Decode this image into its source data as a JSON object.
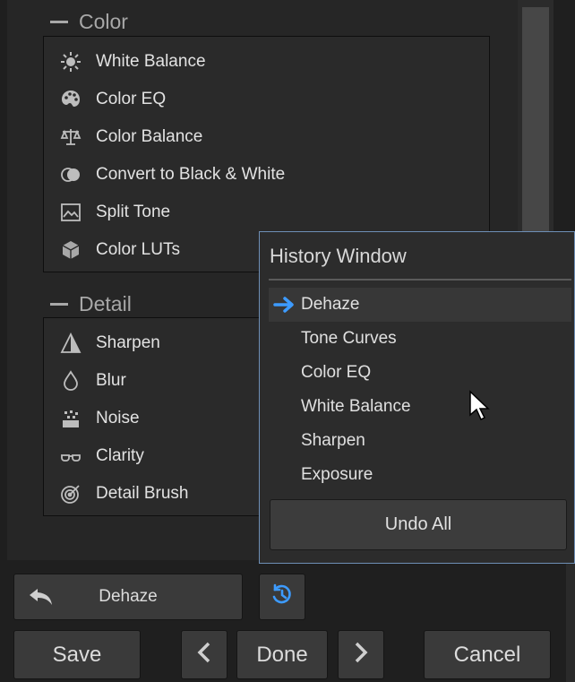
{
  "color_section": {
    "header": "Color",
    "items": [
      {
        "label": "White Balance",
        "icon": "sun-icon"
      },
      {
        "label": "Color EQ",
        "icon": "palette-icon"
      },
      {
        "label": "Color Balance",
        "icon": "scales-icon"
      },
      {
        "label": "Convert to Black & White",
        "icon": "bw-circles-icon"
      },
      {
        "label": "Split Tone",
        "icon": "split-tone-icon"
      },
      {
        "label": "Color LUTs",
        "icon": "cube-icon"
      }
    ]
  },
  "detail_section": {
    "header": "Detail",
    "items": [
      {
        "label": "Sharpen",
        "icon": "sharpen-icon"
      },
      {
        "label": "Blur",
        "icon": "droplet-icon"
      },
      {
        "label": "Noise",
        "icon": "noise-icon"
      },
      {
        "label": "Clarity",
        "icon": "glasses-icon"
      },
      {
        "label": "Detail Brush",
        "icon": "target-brush-icon"
      }
    ]
  },
  "history": {
    "title": "History Window",
    "items": [
      "Dehaze",
      "Tone Curves",
      "Color EQ",
      "White Balance",
      "Sharpen",
      "Exposure"
    ],
    "selected_index": 0,
    "undo_all_label": "Undo All"
  },
  "bottom": {
    "undo_label": "Dehaze",
    "save_label": "Save",
    "done_label": "Done",
    "cancel_label": "Cancel"
  },
  "colors": {
    "accent_blue": "#3d9bff",
    "history_border": "#6e8fb6"
  }
}
